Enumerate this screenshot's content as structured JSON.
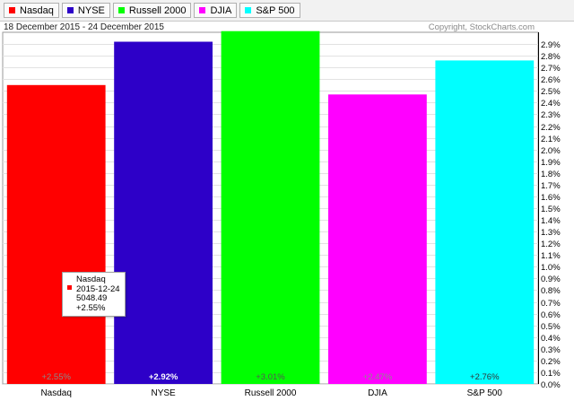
{
  "legend": [
    {
      "label": "Nasdaq",
      "color": "#ff0000"
    },
    {
      "label": "NYSE",
      "color": "#2d00c8"
    },
    {
      "label": "Russell 2000",
      "color": "#00ff00"
    },
    {
      "label": "DJIA",
      "color": "#ff00ff"
    },
    {
      "label": "S&P 500",
      "color": "#00ffff"
    }
  ],
  "date_range": "18 December 2015 - 24 December 2015",
  "copyright": "Copyright, StockCharts.com",
  "tooltip": {
    "name": "Nasdaq",
    "date": "2015-12-24",
    "value": "5048.49",
    "change": "+2.55%",
    "color": "#ff0000"
  },
  "chart_data": {
    "type": "bar",
    "categories": [
      "Nasdaq",
      "NYSE",
      "Russell 2000",
      "DJIA",
      "S&P 500"
    ],
    "values": [
      2.55,
      2.92,
      3.01,
      2.47,
      2.76
    ],
    "value_labels": [
      "+2.55%",
      "+2.92%",
      "+3.01%",
      "+2.47%",
      "+2.76%"
    ],
    "colors": [
      "#ff0000",
      "#2d00c8",
      "#00ff00",
      "#ff00ff",
      "#00ffff"
    ],
    "label_colors": [
      "#8a8a8a",
      "#ffffff",
      "#555555",
      "#8a8a8a",
      "#333333"
    ],
    "ylim": [
      0,
      3.0
    ],
    "yticks": [
      "0.0%",
      "0.1%",
      "0.2%",
      "0.3%",
      "0.4%",
      "0.5%",
      "0.6%",
      "0.7%",
      "0.8%",
      "0.9%",
      "1.0%",
      "1.1%",
      "1.2%",
      "1.3%",
      "1.4%",
      "1.5%",
      "1.6%",
      "1.7%",
      "1.8%",
      "1.9%",
      "2.0%",
      "2.1%",
      "2.2%",
      "2.3%",
      "2.4%",
      "2.5%",
      "2.6%",
      "2.7%",
      "2.8%",
      "2.9%"
    ],
    "grid": true,
    "axis_position": "right"
  }
}
